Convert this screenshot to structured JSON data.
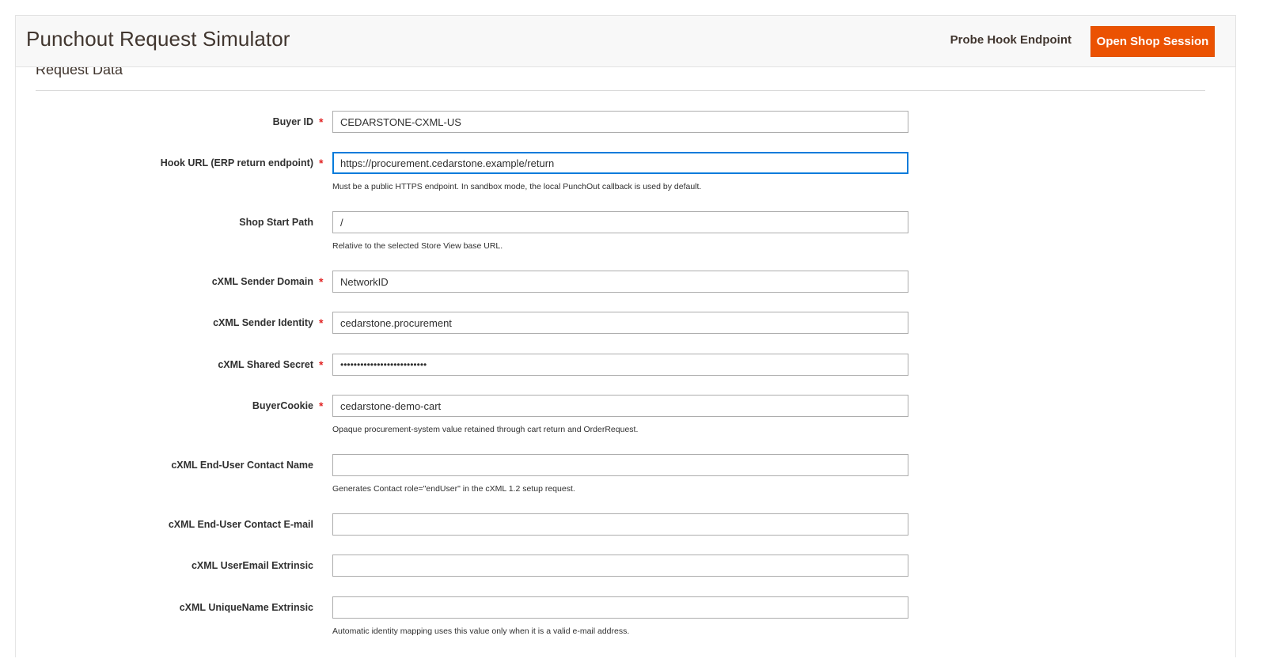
{
  "header": {
    "title": "Punchout Request Simulator",
    "probe_link": "Probe Hook Endpoint",
    "primary_button": "Open Shop Session",
    "accent_color": "#eb5202"
  },
  "section": {
    "title": "Request Data"
  },
  "fields": [
    {
      "label": "Buyer ID",
      "required": "*",
      "value": "CEDARSTONE-CXML-US",
      "note": ""
    },
    {
      "label": "Hook URL (ERP return endpoint)",
      "required": "*",
      "value": "https://procurement.cedarstone.example/return",
      "note": "Must be a public HTTPS endpoint. In sandbox mode, the local PunchOut callback is used by default."
    },
    {
      "label": "Shop Start Path",
      "required": "",
      "value": "/",
      "note": "Relative to the selected Store View base URL."
    },
    {
      "label": "cXML Sender Domain",
      "required": "*",
      "value": "NetworkID",
      "note": ""
    },
    {
      "label": "cXML Sender Identity",
      "required": "*",
      "value": "cedarstone.procurement",
      "note": ""
    },
    {
      "label": "cXML Shared Secret",
      "required": "*",
      "value": "••••••••••••••••••••••••••",
      "note": ""
    },
    {
      "label": "BuyerCookie",
      "required": "*",
      "value": "cedarstone-demo-cart",
      "note": "Opaque procurement-system value retained through cart return and OrderRequest."
    },
    {
      "label": "cXML End-User Contact Name",
      "required": "",
      "value": "",
      "note": "Generates Contact role=\"endUser\" in the cXML 1.2 setup request."
    },
    {
      "label": "cXML End-User Contact E-mail",
      "required": "",
      "value": "",
      "note": ""
    },
    {
      "label": "cXML UserEmail Extrinsic",
      "required": "",
      "value": "",
      "note": ""
    },
    {
      "label": "cXML UniqueName Extrinsic",
      "required": "",
      "value": "",
      "note": "Automatic identity mapping uses this value only when it is a valid e-mail address."
    }
  ]
}
